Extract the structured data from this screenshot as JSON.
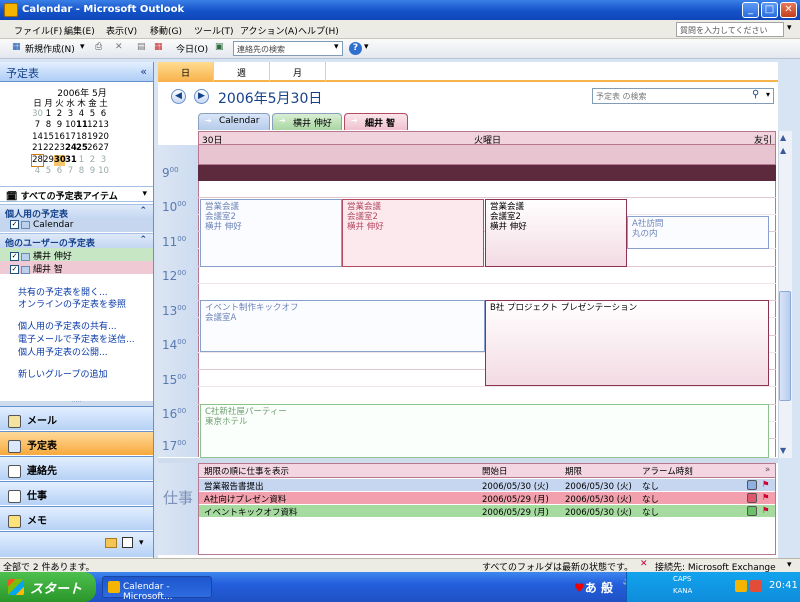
{
  "window": {
    "title": "Calendar - Microsoft Outlook",
    "min": "_",
    "max": "□",
    "close": "✕"
  },
  "menu": {
    "items": [
      "ファイル(F)",
      "編集(E)",
      "表示(V)",
      "移動(G)",
      "ツール(T)",
      "アクション(A)",
      "ヘルプ(H)"
    ],
    "question_placeholder": "質問を入力してください"
  },
  "toolbar": {
    "new_label": "新規作成(N)",
    "today_label": "今日(O)",
    "contact_search_placeholder": "連絡先の検索",
    "help_label": "?"
  },
  "nav": {
    "header": "予定表",
    "collapse": "«",
    "minical": {
      "title": "2006年 5月",
      "weekdays": [
        "日",
        "月",
        "火",
        "水",
        "木",
        "金",
        "土"
      ],
      "weeks": [
        [
          "30",
          "1",
          "2",
          "3",
          "4",
          "5",
          "6"
        ],
        [
          "7",
          "8",
          "9",
          "10",
          "11",
          "12",
          "13"
        ],
        [
          "14",
          "15",
          "16",
          "17",
          "18",
          "19",
          "20"
        ],
        [
          "21",
          "22",
          "23",
          "24",
          "25",
          "26",
          "27"
        ],
        [
          "28",
          "29",
          "30",
          "31",
          "1",
          "2",
          "3"
        ],
        [
          "4",
          "5",
          "6",
          "7",
          "8",
          "9",
          "10"
        ]
      ]
    },
    "all_items_label": "すべての予定表アイテム",
    "personal_section": "個人用の予定表",
    "personal_calendar": "Calendar",
    "others_section": "他のユーザーの予定表",
    "others": [
      "横井 伸好",
      "細井 智"
    ],
    "links": [
      "共有の予定表を開く...",
      "オンラインの予定表を参照",
      "個人用の予定表の共有...",
      "電子メールで予定表を送信...",
      "個人用予定表の公開...",
      "新しいグループの追加"
    ],
    "buttons": [
      "メール",
      "予定表",
      "連絡先",
      "仕事",
      "メモ"
    ]
  },
  "view_tabs": [
    "日",
    "週",
    "月"
  ],
  "calendar": {
    "date_title": "2006年5月30日",
    "search_placeholder": "予定表 の検索",
    "cal_tabs": [
      "Calendar",
      "横井 伸好",
      "細井 智"
    ],
    "day_num": "30日",
    "weekday": "火曜日",
    "right_label": "友引",
    "hours": [
      "9",
      "10",
      "11",
      "12",
      "13",
      "14",
      "15",
      "16",
      "17"
    ],
    "minutes": "00",
    "appointments": [
      {
        "title": "営業会議",
        "room": "会議室2",
        "person": "横井 伸好"
      },
      {
        "title": "営業会議",
        "room": "会議室2",
        "person": "横井 伸好"
      },
      {
        "title": "営業会議",
        "room": "会議室2",
        "person": "横井 伸好"
      },
      {
        "title": "A社訪問",
        "room": "丸の内"
      },
      {
        "title": "イベント制作キックオフ",
        "room": "会議室A"
      },
      {
        "title": "B社 プロジェクト プレゼンテーション"
      },
      {
        "title": "C社新社屋パーティー",
        "room": "東京ホテル"
      }
    ]
  },
  "tasks": {
    "label": "仕事",
    "headers": [
      "期限の順に仕事を表示",
      "開始日",
      "期限",
      "アラーム時刻"
    ],
    "rows": [
      {
        "name": "営業報告書提出",
        "start": "2006/05/30 (火)",
        "due": "2006/05/30 (火)",
        "alarm": "なし",
        "color": "#c7d6f0"
      },
      {
        "name": "A社向けプレゼン資料",
        "start": "2006/05/29 (月)",
        "due": "2006/05/30 (火)",
        "alarm": "なし",
        "color": "#f2a0ad"
      },
      {
        "name": "イベントキックオフ資料",
        "start": "2006/05/29 (月)",
        "due": "2006/05/30 (火)",
        "alarm": "なし",
        "color": "#a6dba0"
      }
    ]
  },
  "status": {
    "left": "全部で 2 件あります。",
    "middle": "すべてのフォルダは最新の状態です。",
    "connection": "接続先: Microsoft Exchange"
  },
  "taskbar": {
    "start": "スタート",
    "item": "Calendar - Microsoft...",
    "ime": "あ 般",
    "caps": "CAPS",
    "kana": "KANA",
    "clock": "20:41"
  },
  "colors": {
    "accent": "#f5b34b",
    "pink_calendar": "#b44b61",
    "blue_calendar": "#6c84b8",
    "green_calendar": "#6d9d6f"
  }
}
